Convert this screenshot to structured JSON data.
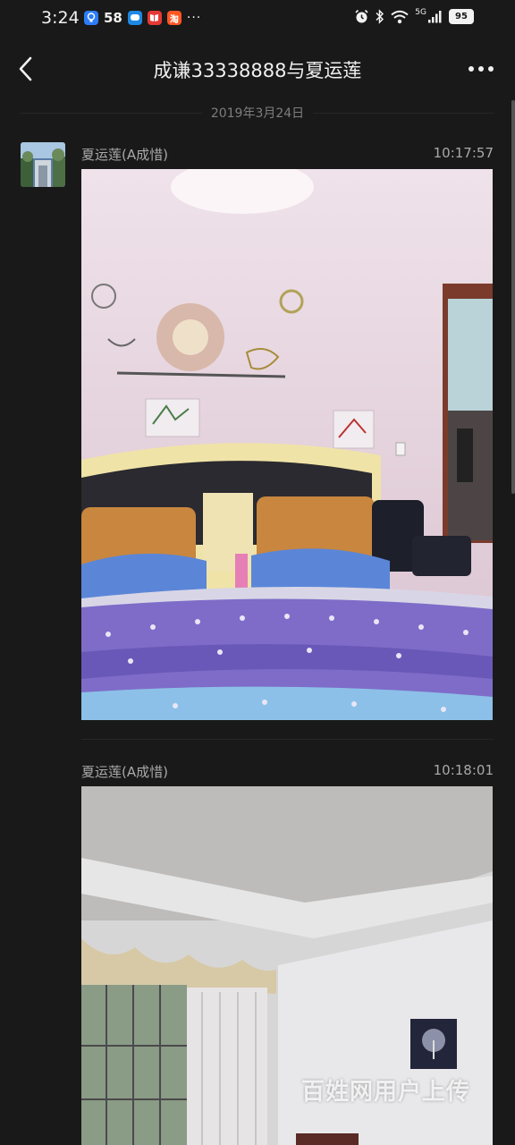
{
  "status_bar": {
    "time": "3:24",
    "app_label_58": "58",
    "taobao_label": "淘",
    "more": "···",
    "network": "5G",
    "battery": "95"
  },
  "header": {
    "title": "成谦33338888与夏运莲"
  },
  "date_separator": "2019年3月24日",
  "messages": [
    {
      "sender": "夏运莲(A成惜)",
      "time": "10:17:57"
    },
    {
      "sender": "夏运莲(A成惜)",
      "time": "10:18:01"
    }
  ],
  "watermark": "百姓网用户上传"
}
